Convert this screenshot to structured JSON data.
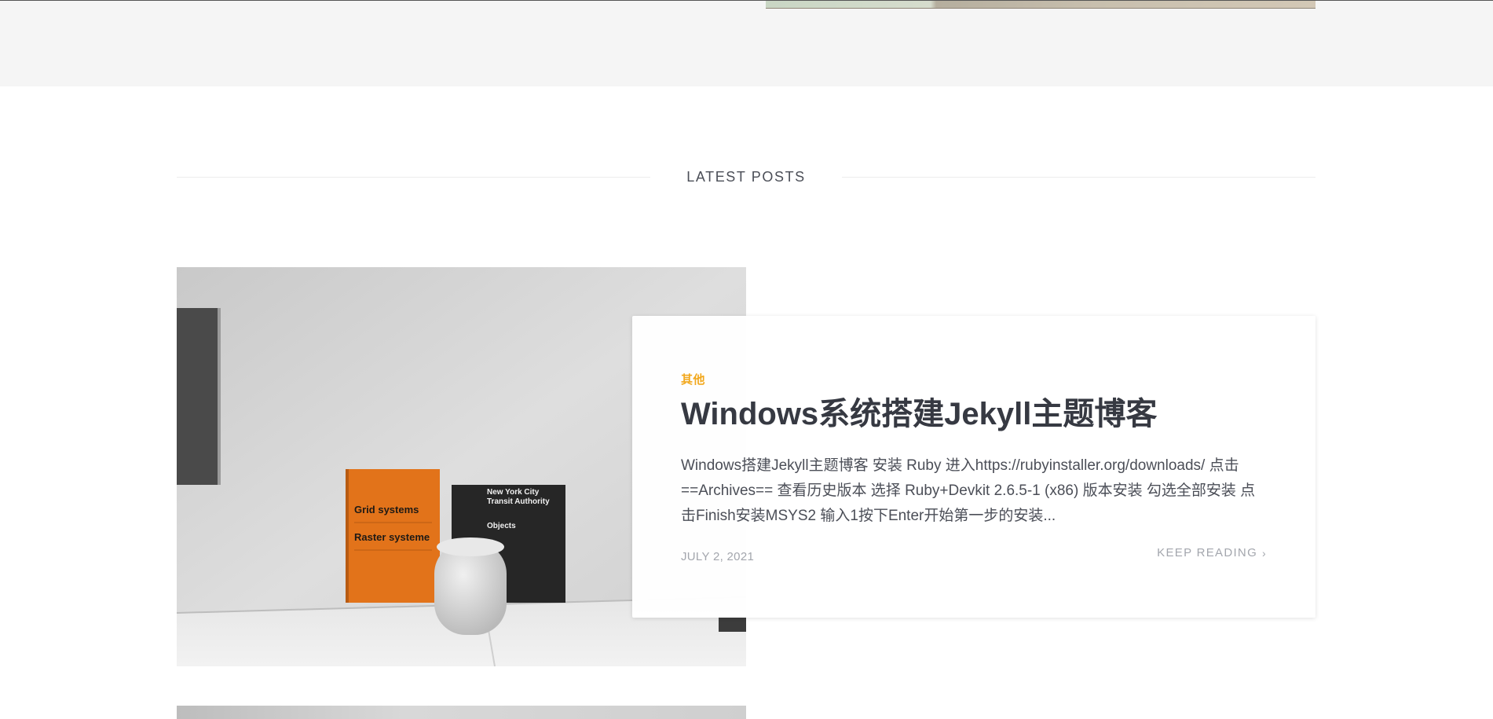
{
  "section": {
    "heading": "LATEST POSTS"
  },
  "post": {
    "category": "其他",
    "title": "Windows系统搭建Jekyll主题博客",
    "excerpt": "Windows搭建Jekyll主题博客 安装 Ruby 进入https://rubyinstaller.org/downloads/ 点击 ==Archives== 查看历史版本 选择 Ruby+Devkit 2.6.5-1 (x86) 版本安装 勾选全部安装 点击Finish安装MSYS2 输入1按下Enter开始第一步的安装...",
    "date": "JULY 2, 2021",
    "keep_reading": "KEEP READING",
    "image": {
      "book1_line1": "Grid systems",
      "book1_line2": "Raster systeme",
      "book2_line1": "New York City",
      "book2_line2": "Transit Authority",
      "book2_line3": "Objects"
    }
  },
  "colors": {
    "accent": "#f2a81d",
    "title": "#363942",
    "muted": "#a3a6ad"
  }
}
